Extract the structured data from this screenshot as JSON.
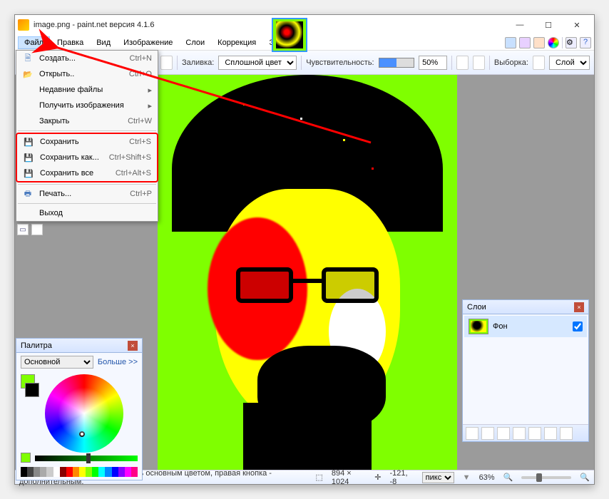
{
  "title": "image.png - paint.net версия 4.1.6",
  "winbtns": {
    "min": "—",
    "max": "☐",
    "close": "✕"
  },
  "menu": {
    "file": "Файл",
    "edit": "Правка",
    "view": "Вид",
    "image": "Изображение",
    "layers": "Слои",
    "correction": "Коррекция",
    "effects": "Эффекты"
  },
  "file_menu": {
    "new": {
      "label": "Создать...",
      "shortcut": "Ctrl+N"
    },
    "open": {
      "label": "Открыть..",
      "shortcut": "Ctrl+O"
    },
    "recent": {
      "label": "Недавние файлы"
    },
    "acquire": {
      "label": "Получить изображения"
    },
    "close": {
      "label": "Закрыть",
      "shortcut": "Ctrl+W"
    },
    "save": {
      "label": "Сохранить",
      "shortcut": "Ctrl+S"
    },
    "saveas": {
      "label": "Сохранить как...",
      "shortcut": "Ctrl+Shift+S"
    },
    "saveall": {
      "label": "Сохранить все",
      "shortcut": "Ctrl+Alt+S"
    },
    "print": {
      "label": "Печать...",
      "shortcut": "Ctrl+P"
    },
    "exit": {
      "label": "Выход"
    }
  },
  "toolbar": {
    "fill_label": "Заливка:",
    "fill_value": "Сплошной цвет",
    "tolerance_label": "Чувствительность:",
    "tolerance_value": "50%",
    "selection_label": "Выборка:",
    "selection_value": "Слой"
  },
  "palette": {
    "title": "Палитра",
    "mode": "Основной",
    "more": "Больше >>"
  },
  "layers_panel": {
    "title": "Слои",
    "layer1": "Фон"
  },
  "status": {
    "hint": "Левая кнопка - заполнить область основным цветом, правая кнопка - дополнительным.",
    "dims": "894 × 1024",
    "pos": "-121, -8",
    "unit": "пикс",
    "zoom": "63%"
  },
  "strip_colors": [
    "#000",
    "#444",
    "#888",
    "#aaa",
    "#ccc",
    "#fff",
    "#800",
    "#f00",
    "#f80",
    "#ff0",
    "#8f0",
    "#0f0",
    "#0ff",
    "#08f",
    "#00f",
    "#80f",
    "#f0f",
    "#f08"
  ]
}
